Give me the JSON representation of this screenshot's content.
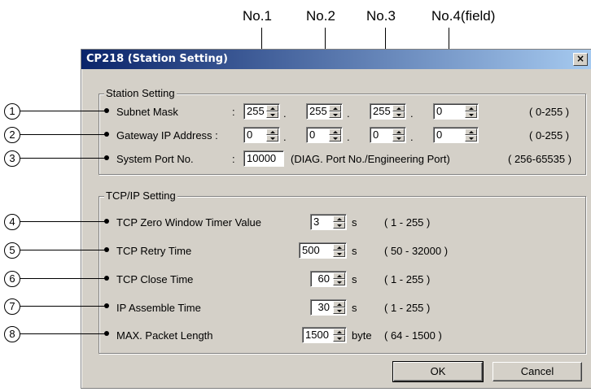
{
  "columns": {
    "no1": "No.1",
    "no2": "No.2",
    "no3": "No.3",
    "no4": "No.4(field)"
  },
  "dialog": {
    "title": "CP218 (Station Setting)",
    "close_glyph": "×"
  },
  "station": {
    "group_title": "Station Setting",
    "subnet_label": "Subnet Mask",
    "colon": ":",
    "subnet": [
      "255",
      "255",
      "255",
      "0"
    ],
    "subnet_range": "( 0-255 )",
    "gateway_label": "Gateway IP Address :",
    "gateway": [
      "0",
      "0",
      "0",
      "0"
    ],
    "gateway_range": "( 0-255 )",
    "port_label": "System Port No.",
    "port_value": "10000",
    "port_note": "(DIAG. Port No./Engineering Port)",
    "port_range": "( 256-65535 )",
    "dot": "."
  },
  "tcp": {
    "group_title": "TCP/IP Setting",
    "rows": [
      {
        "label": "TCP Zero Window Timer Value",
        "value": "3",
        "unit": "s",
        "range": "( 1 - 255 )"
      },
      {
        "label": "TCP Retry Time",
        "value": "500",
        "unit": "s",
        "range": "( 50 - 32000 )"
      },
      {
        "label": "TCP Close Time",
        "value": "60",
        "unit": "s",
        "range": "( 1 - 255 )"
      },
      {
        "label": "IP  Assemble Time",
        "value": "30",
        "unit": "s",
        "range": "( 1 - 255 )"
      },
      {
        "label": "MAX. Packet Length",
        "value": "1500",
        "unit": "byte",
        "range": "( 64 - 1500 )"
      }
    ]
  },
  "callouts": [
    "1",
    "2",
    "3",
    "4",
    "5",
    "6",
    "7",
    "8"
  ],
  "buttons": {
    "ok": "OK",
    "cancel": "Cancel"
  },
  "colors": {
    "title_start": "#0a246a",
    "title_end": "#a6caf0",
    "dialog_bg": "#d4d0c8"
  }
}
